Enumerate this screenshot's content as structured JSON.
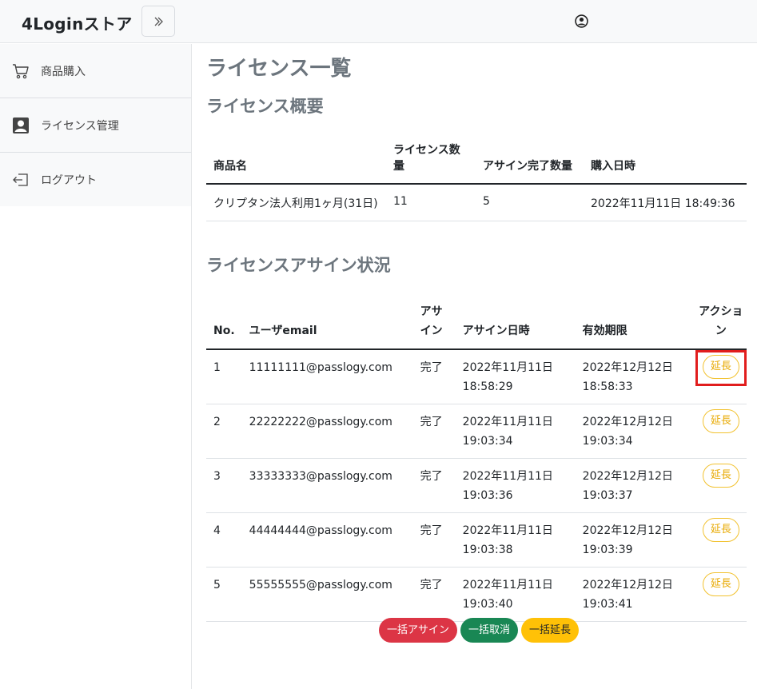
{
  "header": {
    "brand": "4Loginストア"
  },
  "sidebar": {
    "items": [
      {
        "label": "商品購入"
      },
      {
        "label": "ライセンス管理"
      },
      {
        "label": "ログアウト"
      }
    ]
  },
  "main": {
    "title": "ライセンス一覧",
    "summary_title": "ライセンス概要",
    "summary_headers": [
      "商品名",
      "ライセンス数量",
      "アサイン完了数量",
      "購入日時"
    ],
    "summary_row": [
      "クリプタン法人利用1ヶ月(31日)",
      "11",
      "5",
      "2022年11月11日 18:49:36"
    ],
    "assign_title": "ライセンスアサイン状況",
    "assign_headers": {
      "no": "No.",
      "email": "ユーザemail",
      "assign_a": "アサ",
      "assign_b": "イン",
      "assign_date": "アサイン日時",
      "expiry": "有効期限",
      "action_a": "アクショ",
      "action_b": "ン"
    },
    "rows": [
      {
        "no": "1",
        "email": "11111111@passlogy.com",
        "status": "完了",
        "assign_date": "2022年11月11日",
        "assign_time": "18:58:29",
        "expiry_date": "2022年12月12日",
        "expiry_time": "18:58:33",
        "action": "延長"
      },
      {
        "no": "2",
        "email": "22222222@passlogy.com",
        "status": "完了",
        "assign_date": "2022年11月11日",
        "assign_time": "19:03:34",
        "expiry_date": "2022年12月12日",
        "expiry_time": "19:03:34",
        "action": "延長"
      },
      {
        "no": "3",
        "email": "33333333@passlogy.com",
        "status": "完了",
        "assign_date": "2022年11月11日",
        "assign_time": "19:03:36",
        "expiry_date": "2022年12月12日",
        "expiry_time": "19:03:37",
        "action": "延長"
      },
      {
        "no": "4",
        "email": "44444444@passlogy.com",
        "status": "完了",
        "assign_date": "2022年11月11日",
        "assign_time": "19:03:38",
        "expiry_date": "2022年12月12日",
        "expiry_time": "19:03:39",
        "action": "延長"
      },
      {
        "no": "5",
        "email": "55555555@passlogy.com",
        "status": "完了",
        "assign_date": "2022年11月11日",
        "assign_time": "19:03:40",
        "expiry_date": "2022年12月12日",
        "expiry_time": "19:03:41",
        "action": "延長"
      }
    ],
    "bulk": {
      "assign": "一括アサイン",
      "cancel": "一括取消",
      "extend": "一括延長"
    }
  },
  "colors": {
    "danger": "#dc3545",
    "success": "#198754",
    "warning": "#ffc107",
    "highlight": "#e11d1d"
  },
  "icons": {
    "toggle": "chevron-double-right-icon",
    "user": "user-circle-icon",
    "cart": "cart-icon",
    "license": "person-badge-icon",
    "logout": "logout-icon"
  }
}
